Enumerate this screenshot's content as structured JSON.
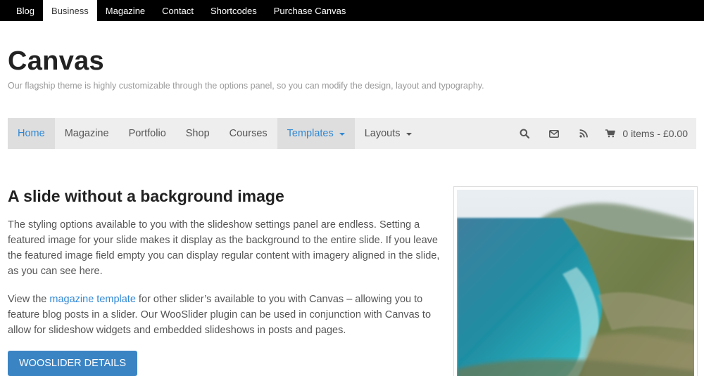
{
  "topbar": {
    "items": [
      {
        "label": "Blog"
      },
      {
        "label": "Business"
      },
      {
        "label": "Magazine"
      },
      {
        "label": "Contact"
      },
      {
        "label": "Shortcodes"
      },
      {
        "label": "Purchase Canvas"
      }
    ],
    "active_index": 1
  },
  "header": {
    "title": "Canvas",
    "description": "Our flagship theme is highly customizable through the options panel, so you can modify the design, layout and typography."
  },
  "mainnav": {
    "items": [
      {
        "label": "Home"
      },
      {
        "label": "Magazine"
      },
      {
        "label": "Portfolio"
      },
      {
        "label": "Shop"
      },
      {
        "label": "Courses"
      },
      {
        "label": "Templates"
      },
      {
        "label": "Layouts"
      }
    ],
    "icons": [
      "search-icon",
      "envelope-icon",
      "rss-icon",
      "cart-icon"
    ],
    "cart_label": "0 items - £0.00",
    "accent_color": "#3088d4"
  },
  "content": {
    "title": "A slide without a background image",
    "paragraph1": "The styling options available to you with the slideshow settings panel are endless. Setting a featured image for your slide makes it display as the background to the entire slide. If you leave the featured image field empty you can display regular content with imagery aligned in the slide, as you can see here.",
    "paragraph2_before": "View the ",
    "paragraph2_link": "magazine template",
    "paragraph2_after": " for other slider’s available to you with Canvas – allowing you to feature blog posts in a slider. Our WooSlider plugin can be used in conjunction with Canvas to allow for slideshow widgets and embedded slideshows in posts and pages.",
    "button_label": "WOOSLIDER DETAILS",
    "button_color": "#3b84c4"
  }
}
